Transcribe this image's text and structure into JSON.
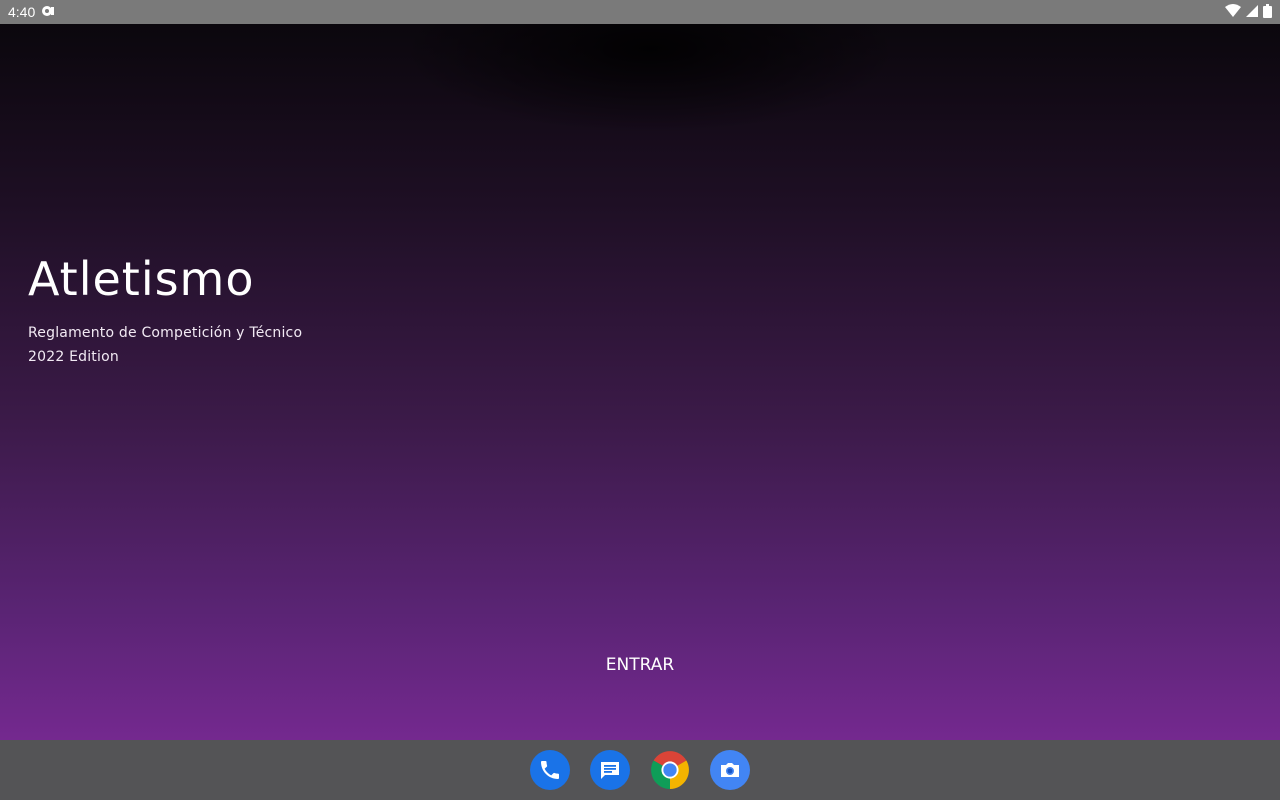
{
  "status_bar": {
    "time": "4:40",
    "icons": [
      "assistant-icon",
      "wifi-icon",
      "signal-icon",
      "battery-icon"
    ]
  },
  "app": {
    "title": "Atletismo",
    "subtitle": "Reglamento de Competición y Técnico",
    "edition": "2022 Edition",
    "enter_label": "ENTRAR"
  },
  "dock": {
    "apps": [
      "phone-icon",
      "messages-icon",
      "chrome-icon",
      "camera-icon"
    ]
  },
  "colors": {
    "gradient_top": "#0b070d",
    "gradient_bottom": "#74298f",
    "status_bar": "#7a7a7a",
    "nav_bar": "#545456"
  }
}
